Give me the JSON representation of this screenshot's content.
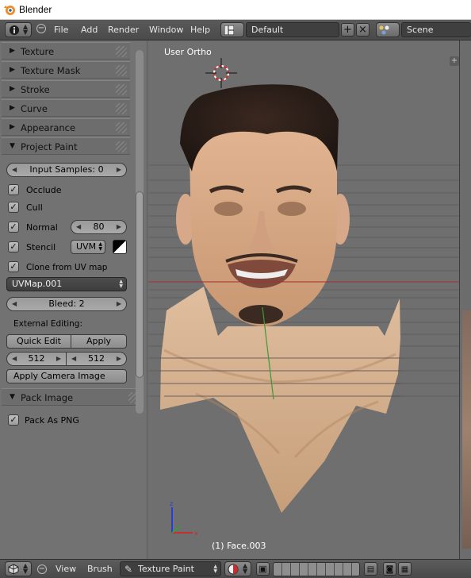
{
  "window": {
    "title": "Blender"
  },
  "topbar": {
    "menus": [
      "File",
      "Add",
      "Render",
      "Window",
      "Help"
    ],
    "screen_layout": "Default",
    "scene": "Scene"
  },
  "toolshelf": {
    "panels_collapsed": [
      "Texture",
      "Texture Mask",
      "Stroke",
      "Curve",
      "Appearance"
    ],
    "project_paint": {
      "header": "Project Paint",
      "input_samples": "Input Samples: 0",
      "occlude": "Occlude",
      "cull": "Cull",
      "normal": "Normal",
      "normal_value": "80",
      "stencil": "Stencil",
      "stencil_layer": "UVM",
      "clone_from_uv": "Clone from UV map",
      "uv_map": "UVMap.001",
      "bleed": "Bleed: 2",
      "external_editing": "External Editing:",
      "quick_edit": "Quick Edit",
      "apply": "Apply",
      "size_x": "512",
      "size_y": "512",
      "apply_camera_image": "Apply Camera Image"
    },
    "pack_image": {
      "header": "Pack Image",
      "pack_as_png": "Pack As PNG"
    }
  },
  "viewport": {
    "view_label": "User Ortho",
    "object_label": "(1) Face.003"
  },
  "bottombar": {
    "menus": [
      "View",
      "Brush"
    ],
    "mode": "Texture Paint"
  },
  "colors": {
    "header_bg": "#4a4a4a",
    "panel_bg": "#727272",
    "viewport_bg": "#6f6f6f",
    "x_axis": "#a03030",
    "y_axis": "#3a9a3a",
    "z_axis": "#2a3fd0"
  }
}
